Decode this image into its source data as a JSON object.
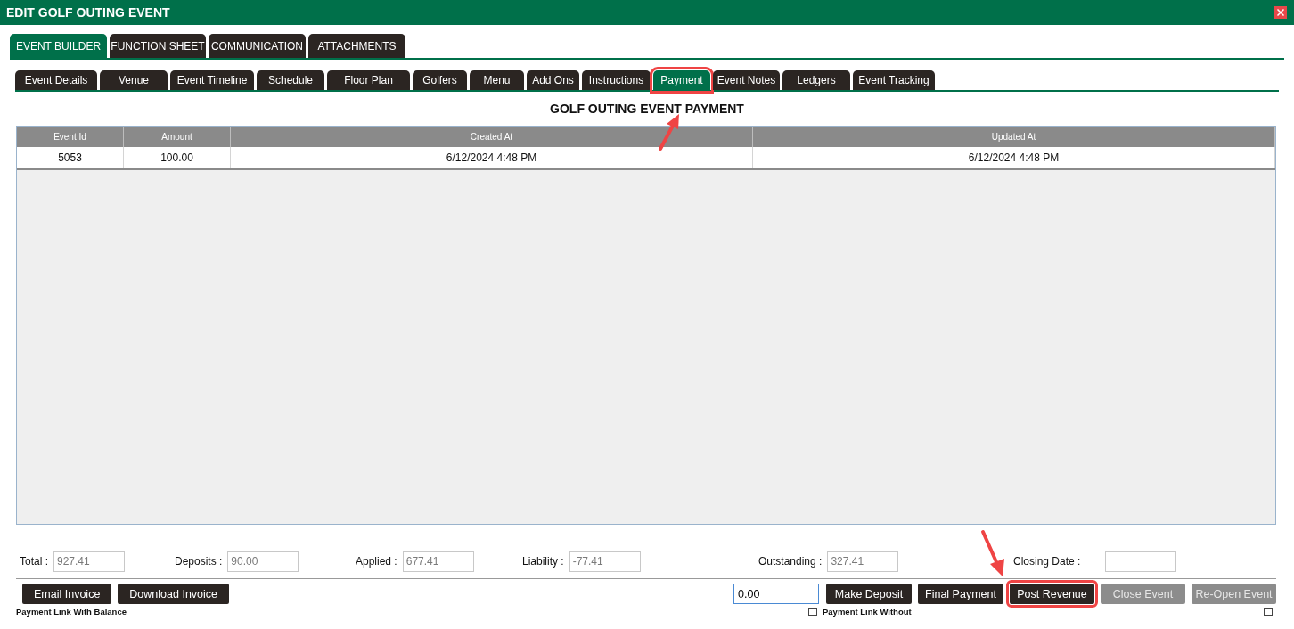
{
  "window": {
    "title": "EDIT GOLF OUTING EVENT"
  },
  "tabs": [
    {
      "label": "EVENT BUILDER",
      "selected": true
    },
    {
      "label": "FUNCTION SHEET",
      "selected": false
    },
    {
      "label": "COMMUNICATION",
      "selected": false
    },
    {
      "label": "ATTACHMENTS",
      "selected": false
    }
  ],
  "subtabs": [
    {
      "label": "Event Details",
      "selected": false,
      "highlighted": false
    },
    {
      "label": "Venue",
      "selected": false,
      "highlighted": false
    },
    {
      "label": "Event Timeline",
      "selected": false,
      "highlighted": false
    },
    {
      "label": "Schedule",
      "selected": false,
      "highlighted": false
    },
    {
      "label": "Floor Plan",
      "selected": false,
      "highlighted": false
    },
    {
      "label": "Golfers",
      "selected": false,
      "highlighted": false
    },
    {
      "label": "Menu",
      "selected": false,
      "highlighted": false
    },
    {
      "label": "Add Ons",
      "selected": false,
      "highlighted": false
    },
    {
      "label": "Instructions",
      "selected": false,
      "highlighted": false
    },
    {
      "label": "Payment",
      "selected": true,
      "highlighted": true
    },
    {
      "label": "Event Notes",
      "selected": false,
      "highlighted": false
    },
    {
      "label": "Ledgers",
      "selected": false,
      "highlighted": false
    },
    {
      "label": "Event Tracking",
      "selected": false,
      "highlighted": false
    }
  ],
  "heading": "GOLF OUTING EVENT PAYMENT",
  "table": {
    "columns": [
      "Event Id",
      "Amount",
      "Created At",
      "Updated At"
    ],
    "rows": [
      [
        "5053",
        "100.00",
        "6/12/2024 4:48 PM",
        "6/12/2024 4:48 PM"
      ]
    ]
  },
  "totals": [
    {
      "label": "Total :",
      "value": "927.41"
    },
    {
      "label": "Deposits :",
      "value": "90.00"
    },
    {
      "label": "Applied :",
      "value": "677.41"
    },
    {
      "label": "Liability :",
      "value": "-77.41"
    },
    {
      "label": "Outstanding :",
      "value": "327.41"
    },
    {
      "label": "Closing Date :"
    }
  ],
  "buttons_left": [
    {
      "label": "Email Invoice",
      "disabled": false,
      "highlighted": false
    },
    {
      "label": "Download Invoice",
      "disabled": false,
      "highlighted": false
    }
  ],
  "amount_field": {
    "value": "0.00"
  },
  "buttons_right": [
    {
      "label": "Make Deposit",
      "disabled": false,
      "highlighted": false
    },
    {
      "label": "Final Payment",
      "disabled": false,
      "highlighted": false
    },
    {
      "label": "Post Revenue",
      "disabled": false,
      "highlighted": true
    },
    {
      "label": "Close Event",
      "disabled": true,
      "highlighted": false
    },
    {
      "label": "Re-Open Event",
      "disabled": true,
      "highlighted": false
    }
  ],
  "payment_links": [
    "Payment Link With Balance",
    "Payment Link Without"
  ]
}
